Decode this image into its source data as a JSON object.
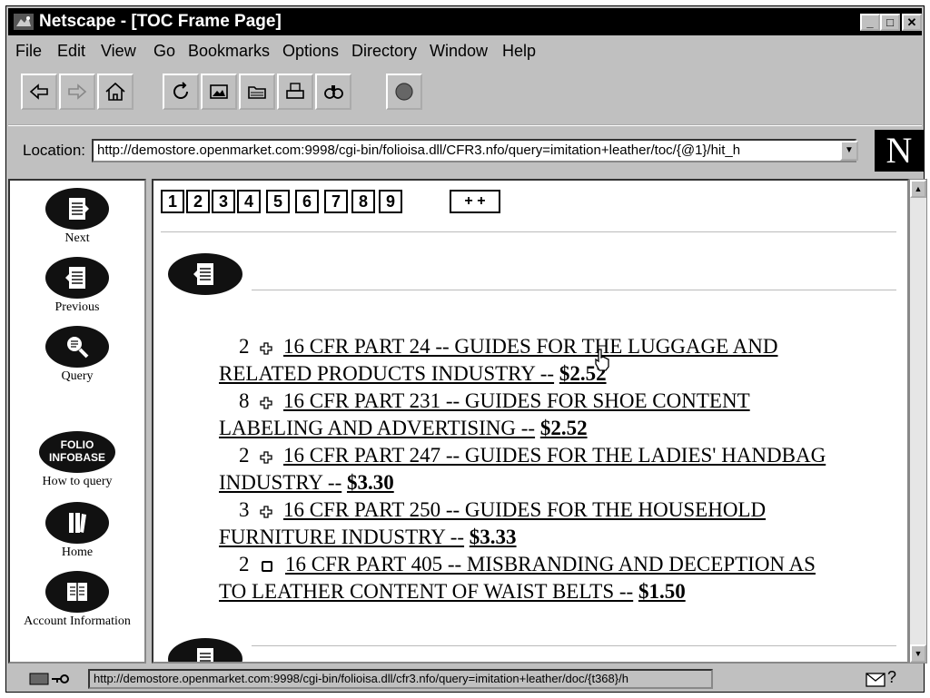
{
  "window": {
    "title": "Netscape - [TOC Frame Page]"
  },
  "menu": [
    "File",
    "Edit",
    "View",
    "Go",
    "Bookmarks",
    "Options",
    "Directory",
    "Window",
    "Help"
  ],
  "toolbar": [
    "back-icon",
    "forward-icon",
    "home-icon",
    "reload-icon",
    "images-icon",
    "open-icon",
    "print-icon",
    "find-icon",
    "stop-icon"
  ],
  "location": {
    "label": "Location:",
    "url": "http://demostore.openmarket.com:9998/cgi-bin/folioisa.dll/CFR3.nfo/query=imitation+leather/toc/{@1}/hit_h",
    "logo": "N"
  },
  "nav": {
    "next": "Next",
    "previous": "Previous",
    "query": "Query",
    "folio": [
      "FOLIO",
      "INFOBASE"
    ],
    "howto": "How to query",
    "home": "Home",
    "account": "Account Information"
  },
  "pages": [
    "1",
    "2",
    "3",
    "4",
    "5",
    "6",
    "7",
    "8",
    "9"
  ],
  "more": "+ +",
  "toc": [
    {
      "count": "2",
      "title": "16 CFR PART 24 -- GUIDES FOR THE LUGGAGE AND",
      "title_cont": "RELATED PRODUCTS INDUSTRY --",
      "price": "$2.52",
      "icon": "plus-icon"
    },
    {
      "count": "8",
      "title": "16 CFR PART 231 -- GUIDES FOR SHOE CONTENT",
      "title_cont": "LABELING AND ADVERTISING --",
      "price": "$2.52",
      "icon": "plus-icon"
    },
    {
      "count": "2",
      "title": "16 CFR PART 247 -- GUIDES FOR THE LADIES' HANDBAG",
      "title_cont": "INDUSTRY --",
      "price": "$3.30",
      "icon": "plus-icon"
    },
    {
      "count": "3",
      "title": "16 CFR PART 250 -- GUIDES FOR THE HOUSEHOLD",
      "title_cont": "FURNITURE INDUSTRY --",
      "price": "$3.33",
      "icon": "plus-icon"
    },
    {
      "count": "2",
      "title": "16 CFR PART 405 -- MISBRANDING AND DECEPTION AS",
      "title_cont": "TO LEATHER CONTENT OF WAIST BELTS --",
      "price": "$1.50",
      "icon": "document-icon"
    }
  ],
  "status": {
    "url": "http://demostore.openmarket.com:9998/cgi-bin/folioisa.dll/cfr3.nfo/query=imitation+leather/doc/{t368}/h",
    "help": "?"
  }
}
